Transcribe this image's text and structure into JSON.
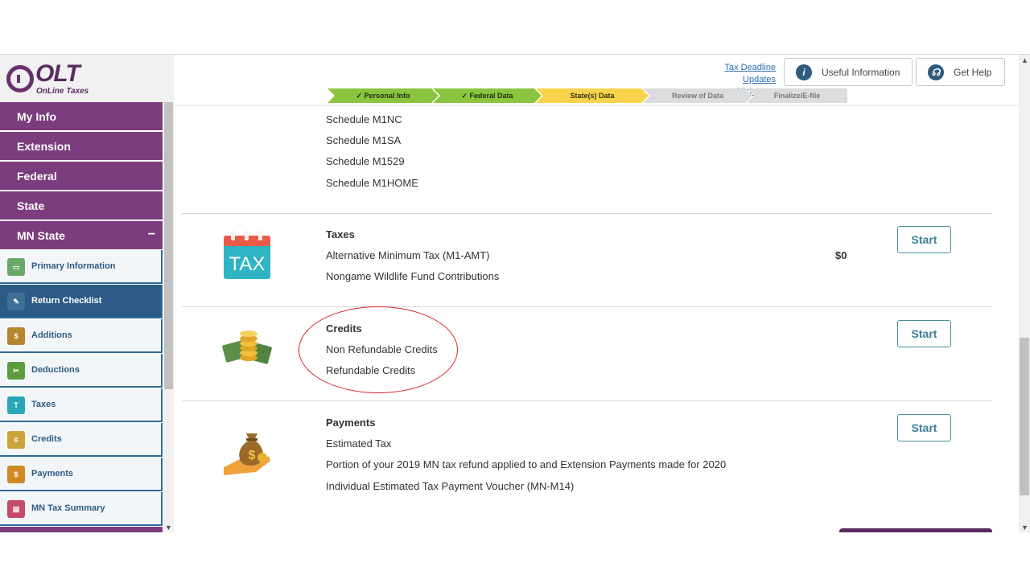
{
  "logo": {
    "brand": "OLT",
    "tagline": "OnLine Taxes"
  },
  "sidebar": {
    "main_items": [
      {
        "label": "My Info"
      },
      {
        "label": "Extension"
      },
      {
        "label": "Federal"
      },
      {
        "label": "State"
      },
      {
        "label": "MN State",
        "toggle": "−"
      }
    ],
    "sub_items": [
      {
        "label": "Primary Information",
        "icon": "id-card-icon",
        "color": "#6aa86a",
        "active": false
      },
      {
        "label": "Return Checklist",
        "icon": "checklist-icon",
        "color": "#3e6f96",
        "active": true
      },
      {
        "label": "Additions",
        "icon": "money-bag-icon",
        "color": "#b5862c",
        "active": false
      },
      {
        "label": "Deductions",
        "icon": "scissors-icon",
        "color": "#5c9c3e",
        "active": false
      },
      {
        "label": "Taxes",
        "icon": "tax-calendar-icon",
        "color": "#2aa7b6",
        "active": false
      },
      {
        "label": "Credits",
        "icon": "coins-icon",
        "color": "#caa43a",
        "active": false
      },
      {
        "label": "Payments",
        "icon": "hand-money-icon",
        "color": "#d08a23",
        "active": false
      },
      {
        "label": "MN Tax Summary",
        "icon": "chart-icon",
        "color": "#c44a6a",
        "active": false
      }
    ]
  },
  "header": {
    "deadline_line1": "Tax Deadline Updates",
    "deadline_line2": "Click Here",
    "useful_info": "Useful Information",
    "get_help": "Get Help",
    "steps": [
      {
        "label": "✓  Personal Info",
        "status": "done"
      },
      {
        "label": "✓  Federal Data",
        "status": "done"
      },
      {
        "label": "State(s) Data",
        "status": "current"
      },
      {
        "label": "Review of Data",
        "status": "todo"
      },
      {
        "label": "Finalize/E-file",
        "status": "todo"
      }
    ]
  },
  "sections": {
    "schedules": [
      "Schedule M1NC",
      "Schedule M1SA",
      "Schedule M1529",
      "Schedule M1HOME"
    ],
    "taxes": {
      "title": "Taxes",
      "items": [
        "Alternative Minimum Tax (M1-AMT)",
        "Nongame Wildlife Fund Contributions"
      ],
      "amount": "$0",
      "start": "Start",
      "icon_text": "TAX"
    },
    "credits": {
      "title": "Credits",
      "items": [
        "Non Refundable Credits",
        "Refundable Credits"
      ],
      "start": "Start"
    },
    "payments": {
      "title": "Payments",
      "items": [
        "Estimated Tax",
        "Portion of your 2019 MN tax refund applied to and Extension Payments made for 2020",
        "Individual Estimated Tax Payment Voucher (MN-M14)"
      ],
      "start": "Start"
    }
  },
  "colors": {
    "brand_purple": "#7b3d7e",
    "active_blue": "#2c5b86",
    "step_done": "#8bc540",
    "step_current": "#f7d44c"
  }
}
